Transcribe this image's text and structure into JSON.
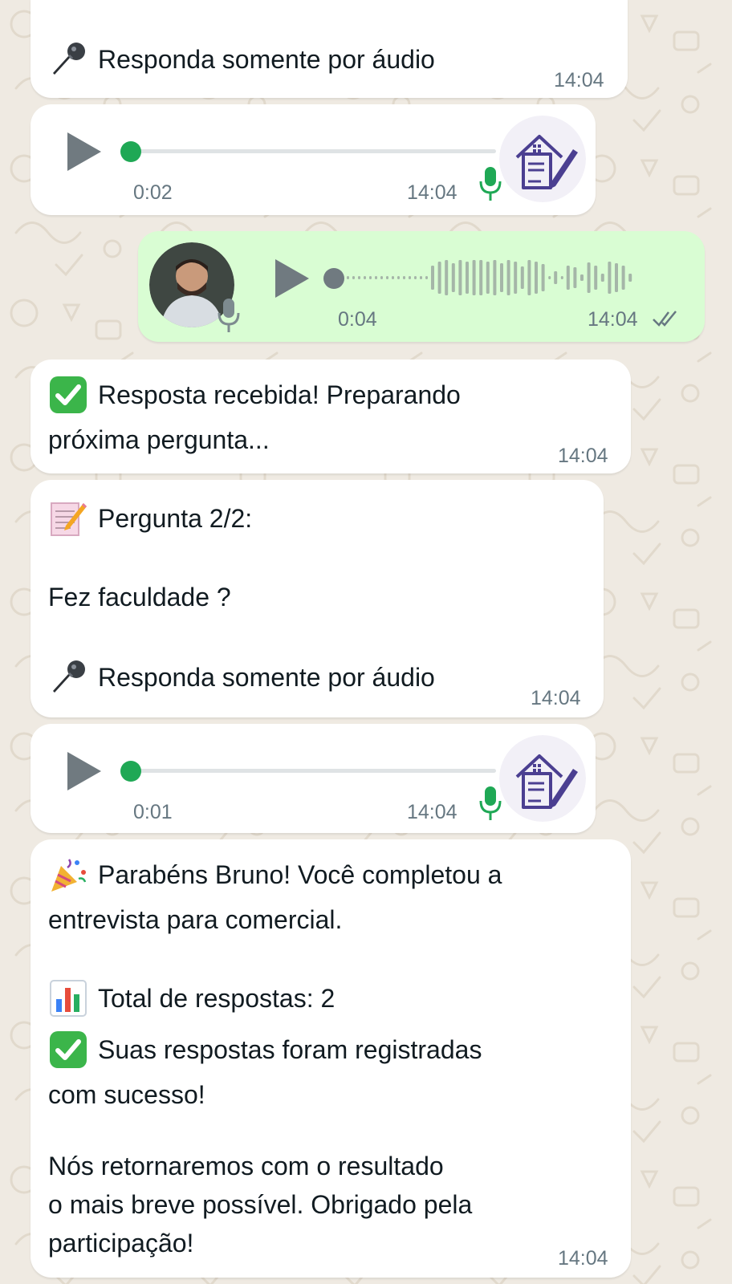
{
  "colors": {
    "wallpaper": "#efeae2",
    "incoming_bubble": "#ffffff",
    "outgoing_bubble": "#d9fdd3",
    "accent_green": "#1fa855",
    "timestamp": "#667781",
    "logo_purple": "#4b3f91"
  },
  "messages": [
    {
      "type": "text",
      "direction": "incoming",
      "lines": [
        {
          "emoji": "microphone",
          "text": "Responda somente por áudio"
        }
      ],
      "time": "14:04"
    },
    {
      "type": "audio",
      "direction": "incoming",
      "duration": "0:02",
      "time": "14:04",
      "progress": 0,
      "avatar": "real-estate-document-pen-logo",
      "mic_status": "played"
    },
    {
      "type": "audio",
      "direction": "outgoing",
      "duration": "0:04",
      "time": "14:04",
      "progress": 0,
      "avatar": "sender-profile-photo",
      "mic_status": "sent",
      "ticks": "double-check"
    },
    {
      "type": "text",
      "direction": "incoming",
      "lines": [
        {
          "emoji": "check-mark-button",
          "text": "Resposta recebida! Preparando"
        },
        {
          "text": "próxima pergunta..."
        }
      ],
      "time": "14:04"
    },
    {
      "type": "text",
      "direction": "incoming",
      "lines": [
        {
          "emoji": "memo",
          "text": "Pergunta 2/2:"
        },
        {
          "text": ""
        },
        {
          "text": "Fez faculdade ?"
        },
        {
          "text": ""
        },
        {
          "emoji": "microphone",
          "text": "Responda somente por áudio"
        }
      ],
      "time": "14:04"
    },
    {
      "type": "audio",
      "direction": "incoming",
      "duration": "0:01",
      "time": "14:04",
      "progress": 0,
      "avatar": "real-estate-document-pen-logo",
      "mic_status": "played"
    },
    {
      "type": "text",
      "direction": "incoming",
      "lines": [
        {
          "emoji": "party-popper",
          "text": "Parabéns Bruno! Você completou a"
        },
        {
          "text": "entrevista para comercial."
        },
        {
          "text": ""
        },
        {
          "emoji": "bar-chart",
          "text": "Total de respostas: 2"
        },
        {
          "emoji": "check-mark-button",
          "text": "Suas respostas foram registradas"
        },
        {
          "text": "com sucesso!"
        },
        {
          "text": ""
        },
        {
          "text": "Nós retornaremos com o resultado"
        },
        {
          "text": "o mais breve possível. Obrigado pela"
        },
        {
          "text": "participação!"
        }
      ],
      "time": "14:04"
    }
  ]
}
